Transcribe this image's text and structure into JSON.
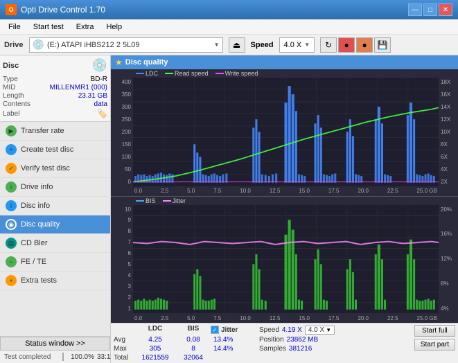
{
  "titleBar": {
    "title": "Opti Drive Control 1.70",
    "icon": "O",
    "controls": [
      "—",
      "□",
      "×"
    ]
  },
  "menuBar": {
    "items": [
      "File",
      "Start test",
      "Extra",
      "Help"
    ]
  },
  "driveBar": {
    "label": "Drive",
    "driveText": "(E:)  ATAPI iHBS212  2 5L09",
    "speedLabel": "Speed",
    "speedValue": "4.0 X"
  },
  "disc": {
    "title": "Disc",
    "type_label": "Type",
    "type_val": "BD-R",
    "mid_label": "MID",
    "mid_val": "MILLENMR1 (000)",
    "length_label": "Length",
    "length_val": "23.31 GB",
    "contents_label": "Contents",
    "contents_val": "data",
    "label_label": "Label"
  },
  "navigation": {
    "items": [
      {
        "id": "transfer-rate",
        "label": "Transfer rate",
        "icon": "green"
      },
      {
        "id": "create-test-disc",
        "label": "Create test disc",
        "icon": "blue"
      },
      {
        "id": "verify-test-disc",
        "label": "Verify test disc",
        "icon": "orange"
      },
      {
        "id": "drive-info",
        "label": "Drive info",
        "icon": "green"
      },
      {
        "id": "disc-info",
        "label": "Disc info",
        "icon": "blue"
      },
      {
        "id": "disc-quality",
        "label": "Disc quality",
        "icon": "blue",
        "active": true
      },
      {
        "id": "cd-bler",
        "label": "CD Bler",
        "icon": "teal"
      },
      {
        "id": "fe-te",
        "label": "FE / TE",
        "icon": "green"
      },
      {
        "id": "extra-tests",
        "label": "Extra tests",
        "icon": "orange"
      }
    ]
  },
  "chartHeader": {
    "title": "Disc quality"
  },
  "topChart": {
    "title": "LDC",
    "legend": [
      {
        "label": "LDC",
        "color": "#4488ff"
      },
      {
        "label": "Read speed",
        "color": "#44ff44"
      },
      {
        "label": "Write speed",
        "color": "#ff44ff"
      }
    ],
    "yAxis": [
      "400",
      "350",
      "300",
      "250",
      "200",
      "150",
      "100",
      "50",
      "0"
    ],
    "yAxisRight": [
      "18X",
      "16X",
      "14X",
      "12X",
      "10X",
      "8X",
      "6X",
      "4X",
      "2X"
    ],
    "xAxis": [
      "0.0",
      "2.5",
      "5.0",
      "7.5",
      "10.0",
      "12.5",
      "15.0",
      "17.5",
      "20.0",
      "22.5",
      "25.0"
    ],
    "xAxisUnit": "GB"
  },
  "bottomChart": {
    "title": "BIS",
    "legendItems": [
      {
        "label": "BIS",
        "color": "#44aaff"
      },
      {
        "label": "Jitter",
        "color": "#ff88ff"
      }
    ],
    "yAxis": [
      "10",
      "9",
      "8",
      "7",
      "6",
      "5",
      "4",
      "3",
      "2",
      "1"
    ],
    "yAxisRight": [
      "20%",
      "16%",
      "12%",
      "8%",
      "4%"
    ],
    "xAxis": [
      "0.0",
      "2.5",
      "5.0",
      "7.5",
      "10.0",
      "12.5",
      "15.0",
      "17.5",
      "20.0",
      "22.5",
      "25.0"
    ],
    "xAxisUnit": "GB"
  },
  "stats": {
    "headers": [
      "",
      "LDC",
      "BIS",
      "",
      "Jitter",
      "Speed"
    ],
    "avg_label": "Avg",
    "max_label": "Max",
    "total_label": "Total",
    "ldc_avg": "4.25",
    "ldc_max": "305",
    "ldc_total": "1621559",
    "bis_avg": "0.08",
    "bis_max": "8",
    "bis_total": "32064",
    "jitter_avg": "13.4%",
    "jitter_max": "14.4%",
    "jitter_checked": true,
    "speed_label": "Speed",
    "speed_val": "4.19 X",
    "speed_setting": "4.0 X",
    "position_label": "Position",
    "position_val": "23862 MB",
    "samples_label": "Samples",
    "samples_val": "381216"
  },
  "buttons": {
    "start_full": "Start full",
    "start_part": "Start part"
  },
  "statusArea": {
    "status_window_btn": "Status window >>",
    "status_text": "Test completed",
    "progress": 100,
    "progress_text": "100.0%",
    "time": "33:11"
  }
}
